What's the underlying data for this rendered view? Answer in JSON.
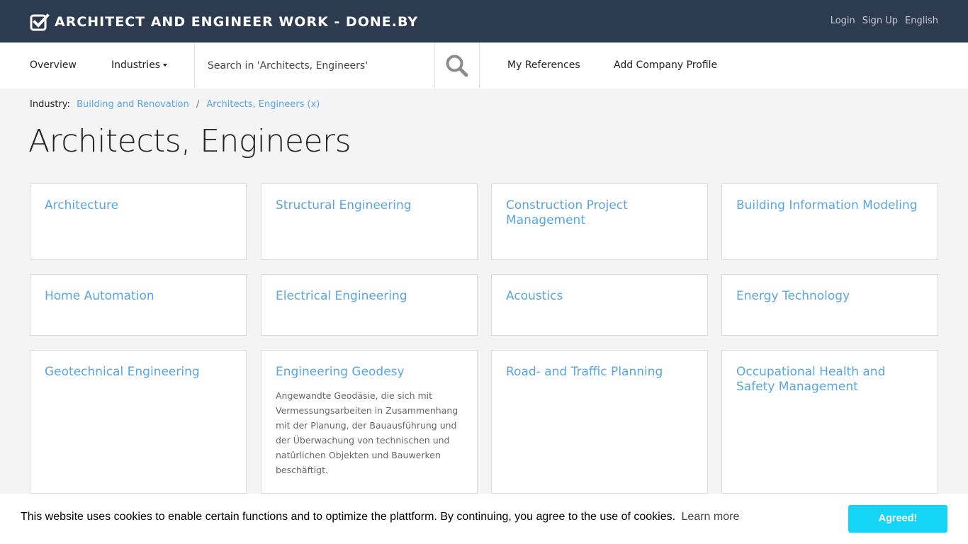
{
  "header": {
    "title": "ARCHITECT AND ENGINEER WORK - DONE.BY",
    "links": [
      "Login",
      "Sign Up",
      "English"
    ]
  },
  "nav": {
    "overview": "Overview",
    "industries": "Industries",
    "search_placeholder": "Search in 'Architects, Engineers'",
    "my_references": "My References",
    "add_company_profile": "Add Company Profile"
  },
  "breadcrumb": {
    "label": "Industry:",
    "items": [
      "Building and Renovation",
      "Architects, Engineers (x)"
    ],
    "separator": "/"
  },
  "page": {
    "title": "Architects, Engineers"
  },
  "categories": [
    {
      "title": "Architecture",
      "description": ""
    },
    {
      "title": "Structural Engineering",
      "description": ""
    },
    {
      "title": "Construction Project Management",
      "description": ""
    },
    {
      "title": "Building Information Modeling",
      "description": ""
    },
    {
      "title": "Home Automation",
      "description": ""
    },
    {
      "title": "Electrical Engineering",
      "description": ""
    },
    {
      "title": "Acoustics",
      "description": ""
    },
    {
      "title": "Energy Technology",
      "description": ""
    },
    {
      "title": "Geotechnical Engineering",
      "description": ""
    },
    {
      "title": "Engineering Geodesy",
      "description": "Angewandte Geodäsie, die sich mit Vermessungsarbeiten in Zusammenhang mit der Planung, der Bauausführung und der Überwachung von technischen und natürlichen Objekten und Bauwerken beschäftigt."
    },
    {
      "title": "Road- and Traffic Planning",
      "description": ""
    },
    {
      "title": "Occupational Health and Safety Management",
      "description": ""
    }
  ],
  "cookie": {
    "message": "This website uses cookies to enable certain functions and to optimize the plattform. By continuing, you agree to the use of cookies.",
    "learn_more": "Learn more",
    "accept": "Agreed!"
  },
  "colors": {
    "header_bg": "#2c3b50",
    "link": "#5aa6e0",
    "accept_button": "#15d5f7"
  },
  "icons": [
    "checkbox-check-icon",
    "search-icon",
    "caret-down-icon"
  ]
}
